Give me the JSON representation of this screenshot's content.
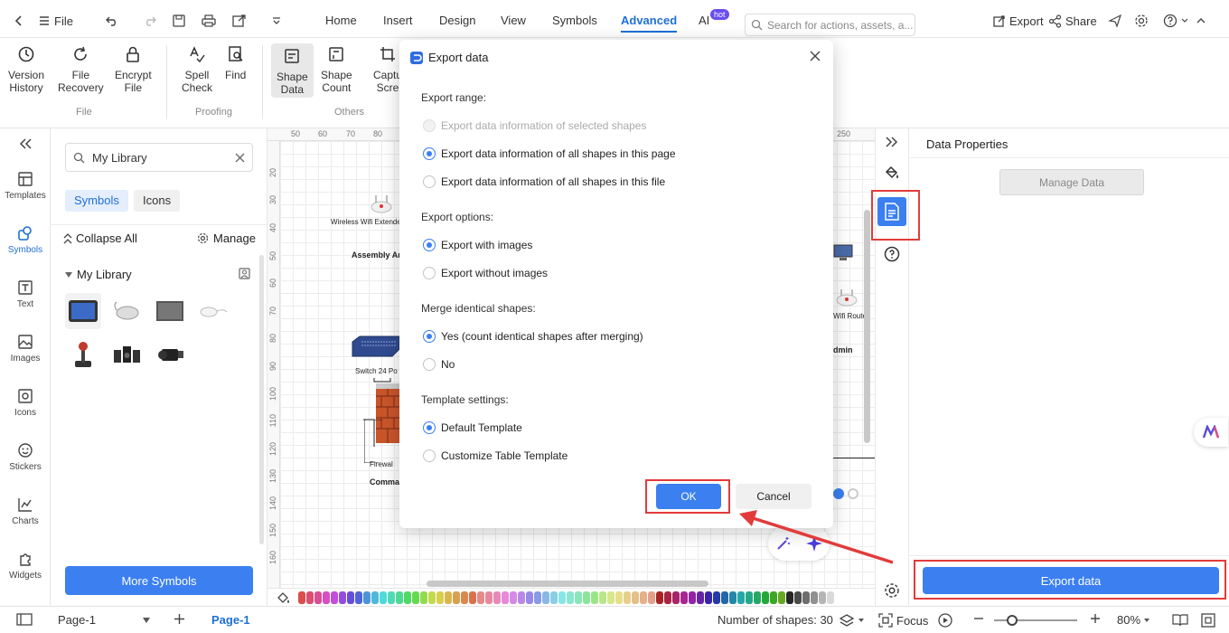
{
  "topbar": {
    "file_label": "File",
    "menu_tabs": [
      "Home",
      "Insert",
      "Design",
      "View",
      "Symbols",
      "Advanced",
      "AI"
    ],
    "active_tab": "Advanced",
    "hot_badge": "hot",
    "search_placeholder": "Search for actions, assets, a...",
    "export_label": "Export",
    "share_label": "Share"
  },
  "ribbon": {
    "buttons": [
      {
        "line1": "Version",
        "line2": "History",
        "icon": "history-icon"
      },
      {
        "line1": "File",
        "line2": "Recovery",
        "icon": "refresh-icon"
      },
      {
        "line1": "Encrypt",
        "line2": "File",
        "icon": "lock-icon"
      },
      {
        "line1": "Spell",
        "line2": "Check",
        "icon": "spell-check-icon"
      },
      {
        "line1": "Find",
        "line2": "",
        "icon": "find-icon"
      },
      {
        "line1": "Shape",
        "line2": "Data",
        "icon": "shape-data-icon"
      },
      {
        "line1": "Shape",
        "line2": "Count",
        "icon": "shape-count-icon"
      },
      {
        "line1": "Captu",
        "line2": "Scre",
        "icon": "crop-icon"
      }
    ],
    "groups": [
      "File",
      "Proofing",
      "Others"
    ]
  },
  "rail": {
    "items": [
      "Templates",
      "Symbols",
      "Text",
      "Images",
      "Icons",
      "Stickers",
      "Charts",
      "Widgets"
    ],
    "active": "Symbols"
  },
  "library": {
    "search_value": "My Library",
    "chips": [
      "Symbols",
      "Icons"
    ],
    "collapse_all": "Collapse All",
    "manage": "Manage",
    "section": "My Library",
    "more_symbols": "More Symbols"
  },
  "canvas": {
    "ruler_top": [
      "50",
      "60",
      "70",
      "80",
      "250"
    ],
    "ruler_left": [
      "20",
      "30",
      "40",
      "50",
      "60",
      "70",
      "80",
      "90",
      "100",
      "110",
      "120",
      "130",
      "140",
      "150",
      "160"
    ],
    "labels": [
      "Wireless Wifi Extende",
      "Assembly Ar",
      "Switch 24 Po",
      "Firewal",
      "Comma",
      "Wifi Route",
      "dmin"
    ]
  },
  "dialog": {
    "title": "Export data",
    "sections": [
      {
        "title": "Export range:",
        "options": [
          {
            "label": "Export data information of selected shapes",
            "checked": false,
            "disabled": true
          },
          {
            "label": "Export data information of all shapes in this page",
            "checked": true,
            "disabled": false
          },
          {
            "label": "Export data information of all shapes in this file",
            "checked": false,
            "disabled": false
          }
        ]
      },
      {
        "title": "Export options:",
        "options": [
          {
            "label": "Export with images",
            "checked": true,
            "disabled": false
          },
          {
            "label": "Export without images",
            "checked": false,
            "disabled": false
          }
        ]
      },
      {
        "title": "Merge identical shapes:",
        "options": [
          {
            "label": "Yes (count identical shapes after merging)",
            "checked": true,
            "disabled": false
          },
          {
            "label": "No",
            "checked": false,
            "disabled": false
          }
        ]
      },
      {
        "title": "Template settings:",
        "options": [
          {
            "label": "Default Template",
            "checked": true,
            "disabled": false
          },
          {
            "label": "Customize Table Template",
            "checked": false,
            "disabled": false
          }
        ]
      }
    ],
    "ok_label": "OK",
    "cancel_label": "Cancel"
  },
  "props": {
    "title": "Data Properties",
    "manage_data": "Manage Data",
    "export_data": "Export data"
  },
  "statusbar": {
    "page_select": "Page-1",
    "page_tab": "Page-1",
    "shapes_count": "Number of shapes: 30",
    "focus": "Focus",
    "zoom": "80%"
  },
  "colors": {
    "accent": "#3b7ff0",
    "highlight": "#e23b3b"
  }
}
